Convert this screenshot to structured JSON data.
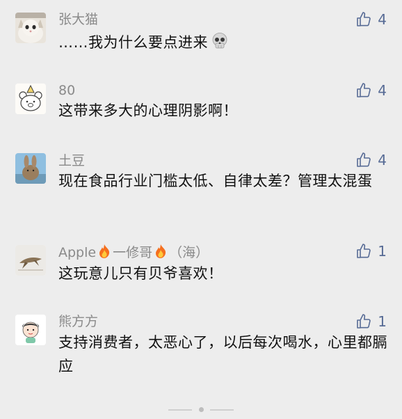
{
  "comments": [
    {
      "name": "张大猫",
      "text": "……我为什么要点进来",
      "likes": "4",
      "avatar": "cat-photo-avatar",
      "emoji": "skull-emoji"
    },
    {
      "name": "80",
      "text": "这带来多大的心理阴影啊！",
      "likes": "4",
      "avatar": "cartoon-bear-avatar"
    },
    {
      "name": "土豆",
      "text": "现在食品行业门槛太低、自律太差？管理太混蛋",
      "likes": "4",
      "avatar": "rabbit-photo-avatar"
    },
    {
      "name_parts": [
        "Apple",
        "一修哥",
        "（海）"
      ],
      "name_icons": [
        "fire-emoji",
        "fire-emoji"
      ],
      "text": "这玩意儿只有贝爷喜欢！",
      "likes": "1",
      "avatar": "bird-photo-avatar"
    },
    {
      "name": "熊方方",
      "text": "支持消费者，太恶心了，以后每次喝水，心里都膈应",
      "likes": "1",
      "avatar": "cartoon-child-avatar"
    }
  ],
  "colors": {
    "background": "#ededed",
    "like_blue": "#576b95",
    "name_gray": "#8a8a8a",
    "text": "#111111"
  }
}
